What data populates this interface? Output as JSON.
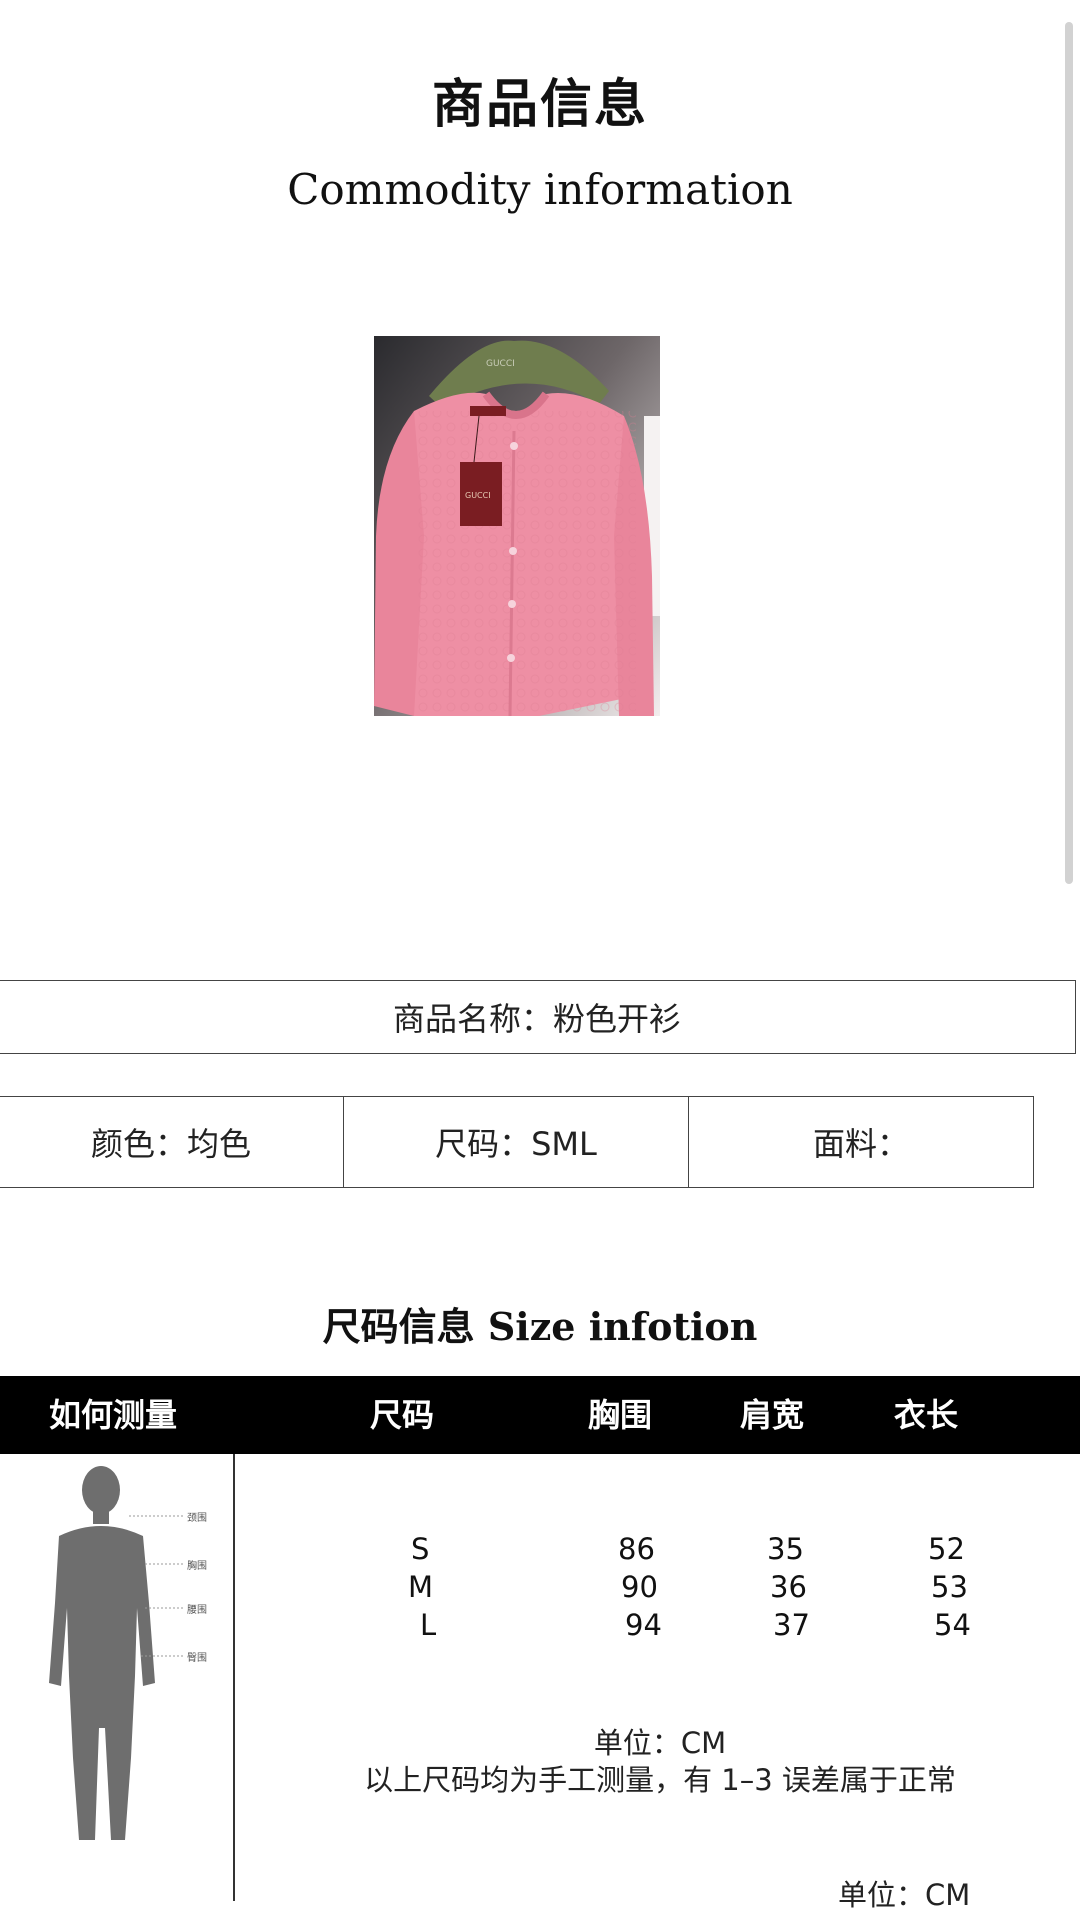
{
  "header": {
    "title_cn": "商品信息",
    "title_en": "Commodity information"
  },
  "product": {
    "image_icon": "pink-cardigan-photo",
    "tag_text": "GUCCI",
    "name": "商品名称：粉色开衫",
    "color": "颜色：均色",
    "sizes": "尺码：SML",
    "fabric": "面料："
  },
  "size_info": {
    "title_cn": "尺码信息",
    "title_en": "Size infotion",
    "headers": [
      "如何测量",
      "尺码",
      "胸围",
      "肩宽",
      "衣长"
    ],
    "rows": [
      [
        "S",
        "86",
        "35",
        "52"
      ],
      [
        "M",
        "90",
        "36",
        "53"
      ],
      [
        "L",
        "94",
        "37",
        "54"
      ]
    ],
    "figure_labels": [
      "颈围",
      "胸围",
      "腰围",
      "臀围"
    ],
    "unit": "单位：CM",
    "note": "以上尺码均为手工测量，有 1–3 误差属于正常",
    "unit_footer": "单位：CM"
  },
  "colors": {
    "cardigan": "#ee8fa4",
    "hanger": "#6f7d4e",
    "tag": "#7a1d22"
  }
}
